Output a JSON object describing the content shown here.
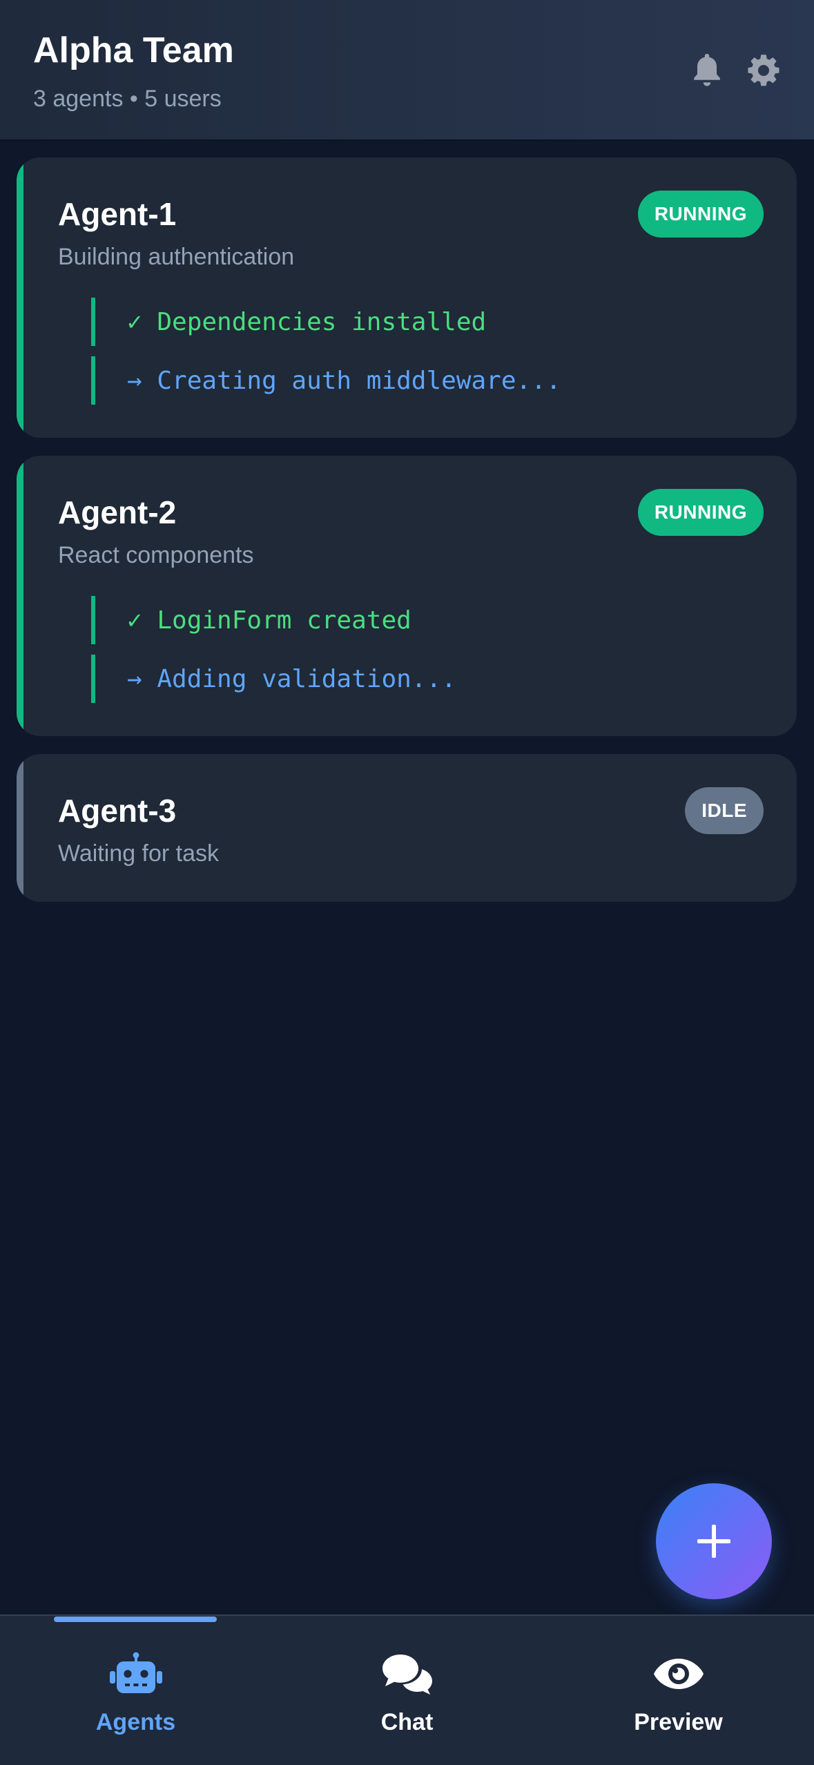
{
  "header": {
    "title": "Alpha Team",
    "subtitle": "3 agents • 5 users",
    "icons": [
      "bell-icon",
      "gear-icon"
    ]
  },
  "agents": [
    {
      "name": "Agent-1",
      "description": "Building authentication",
      "status": "RUNNING",
      "logs": [
        {
          "text": "✓ Dependencies installed",
          "kind": "done"
        },
        {
          "text": "→ Creating auth middleware...",
          "kind": "progress"
        }
      ]
    },
    {
      "name": "Agent-2",
      "description": "React components",
      "status": "RUNNING",
      "logs": [
        {
          "text": "✓ LoginForm created",
          "kind": "done"
        },
        {
          "text": "→ Adding validation...",
          "kind": "progress"
        }
      ]
    },
    {
      "name": "Agent-3",
      "description": "Waiting for task",
      "status": "IDLE",
      "logs": []
    }
  ],
  "fab": {
    "icon": "plus-icon"
  },
  "bottom_nav": {
    "items": [
      {
        "label": "Agents",
        "icon": "robot-icon",
        "active": true
      },
      {
        "label": "Chat",
        "icon": "chat-bubbles-icon",
        "active": false
      },
      {
        "label": "Preview",
        "icon": "eye-icon",
        "active": false
      }
    ]
  },
  "colors": {
    "background": "#0f172a",
    "card": "#1f2937",
    "running": "#10b981",
    "idle": "#64748b",
    "done_text": "#4ade80",
    "progress_text": "#60a5fa",
    "accent_active": "#60a5fa"
  }
}
